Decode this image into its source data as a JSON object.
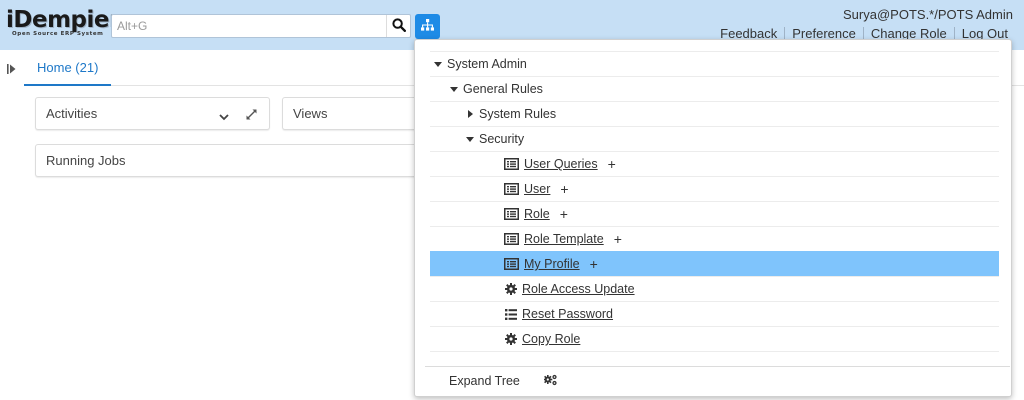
{
  "header": {
    "logo_main": "iDempiere",
    "logo_sub": "Open Source ERP System",
    "search_placeholder": "Alt+G",
    "user": "Surya@POTS.*/POTS Admin",
    "links": [
      "Feedback",
      "Preference",
      "Change Role",
      "Log Out"
    ]
  },
  "tabs": {
    "home": "Home (21)"
  },
  "dashboard": {
    "activities": "Activities",
    "views": "Views",
    "running_jobs": "Running Jobs"
  },
  "tree": {
    "root": "System Admin",
    "general_rules": "General Rules",
    "system_rules": "System Rules",
    "security": "Security",
    "items": [
      {
        "label": "User Queries",
        "icon": "window-icon",
        "plus": "+"
      },
      {
        "label": "User",
        "icon": "window-icon",
        "plus": "+"
      },
      {
        "label": "Role",
        "icon": "window-icon",
        "plus": "+"
      },
      {
        "label": "Role Template",
        "icon": "window-icon",
        "plus": "+"
      },
      {
        "label": "My Profile",
        "icon": "window-icon",
        "plus": "+",
        "selected": true
      },
      {
        "label": "Role Access Update",
        "icon": "gear-icon"
      },
      {
        "label": "Reset Password",
        "icon": "list-icon"
      },
      {
        "label": "Copy Role",
        "icon": "gear-icon"
      }
    ],
    "expand_tree": "Expand Tree"
  },
  "colors": {
    "header_bg": "#c6dff5",
    "accent": "#1e8be6",
    "selected_row": "#7fc4fc"
  }
}
